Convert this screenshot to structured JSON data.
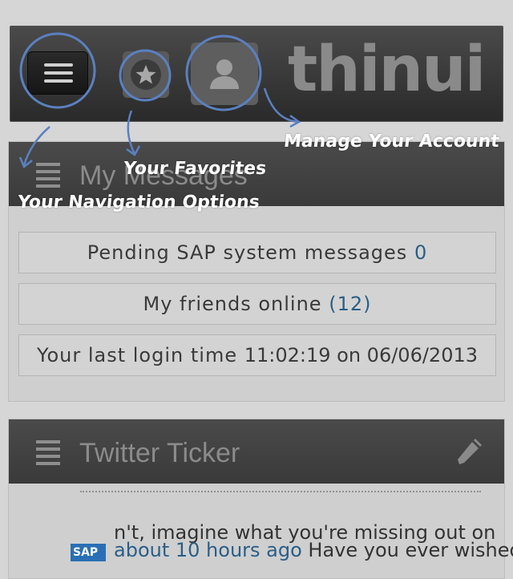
{
  "header": {
    "logo_text": "thinui"
  },
  "messages_panel": {
    "title": "My Messages",
    "rows": [
      {
        "label": "Pending SAP system messages",
        "value": "0"
      },
      {
        "label": "My friends online",
        "value": "(12)"
      },
      {
        "label": "Your last login time",
        "value": "11:02:19 on 06/06/2013"
      }
    ]
  },
  "twitter_panel": {
    "title": "Twitter Ticker",
    "line1": "n't, imagine what you're missing out on",
    "link": "about 10 hours ago",
    "line2_rest": " Have you ever wished",
    "sap_logo": "SAP"
  },
  "annotations": {
    "account": "Manage Your Account",
    "favorites": "Your Favorites",
    "navigation": "Your Navigation Options"
  },
  "colors": {
    "annotation_circle": "#5b80c0",
    "link": "#2a5e88",
    "header_bg": "#3a3a3a"
  },
  "icons": {
    "menu": "hamburger-menu-icon",
    "favorites": "star-icon",
    "account": "user-icon",
    "panel": "list-lines-icon",
    "edit": "pencil-icon"
  }
}
